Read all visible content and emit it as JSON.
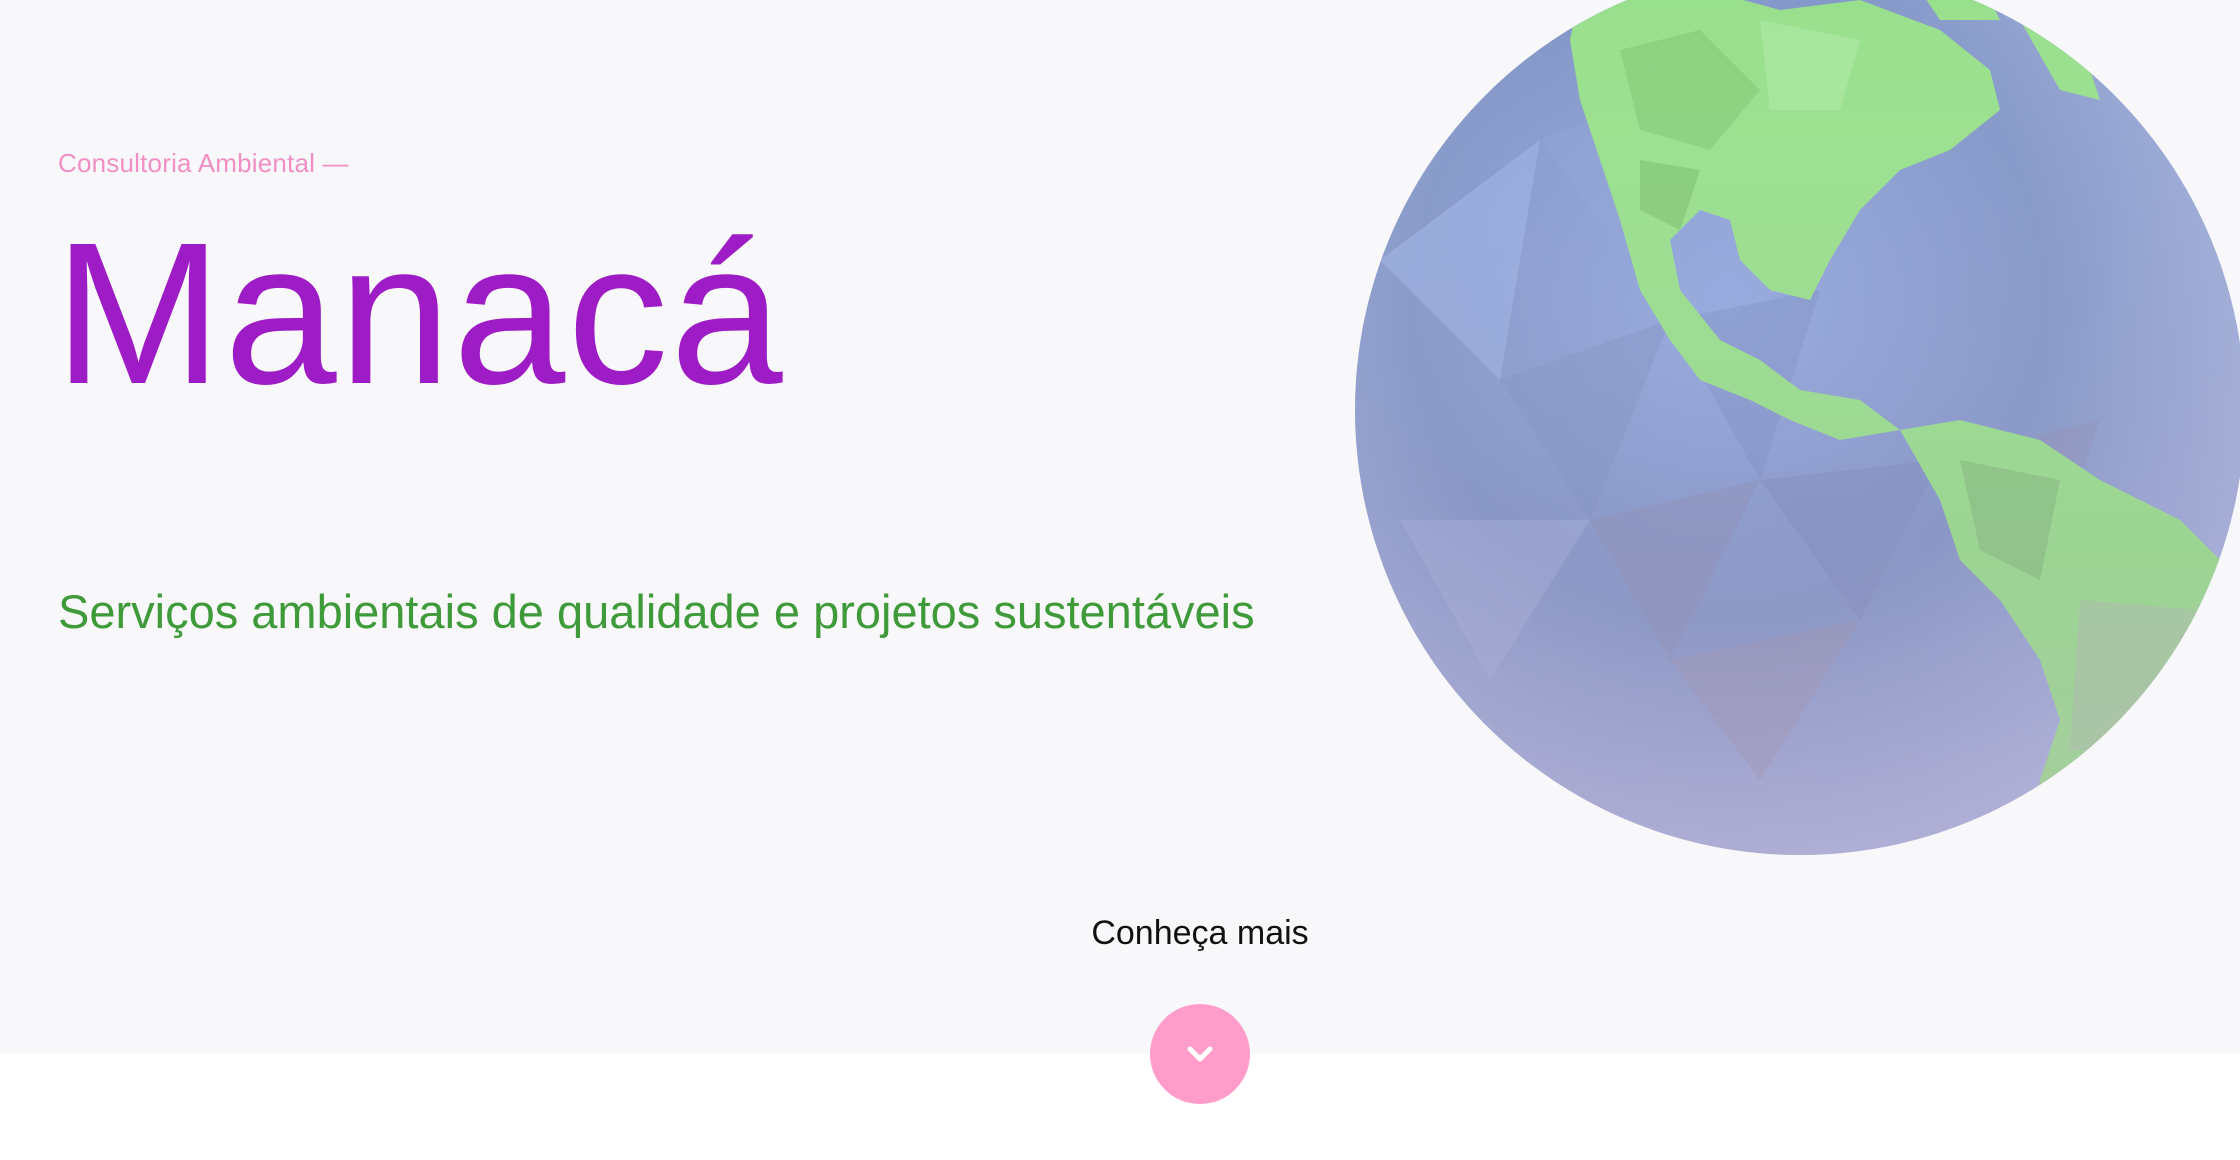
{
  "hero": {
    "eyebrow": "Consultoria Ambiental —",
    "brand": "Manacá",
    "tagline": "Serviços ambientais de qualidade e projetos sustentáveis"
  },
  "cta": {
    "label": "Conheça mais",
    "icon": "chevron-down-icon"
  },
  "globe": {
    "icon": "low-poly-earth-globe",
    "ocean_color": "#8fa6d9",
    "land_color": "#98e08c"
  },
  "colors": {
    "eyebrow": "#f18fc4",
    "brand": "#9d1cc6",
    "tagline": "#3f9a3a",
    "cta_button": "#ff9cc9",
    "hero_background": "#f8f8fa"
  }
}
